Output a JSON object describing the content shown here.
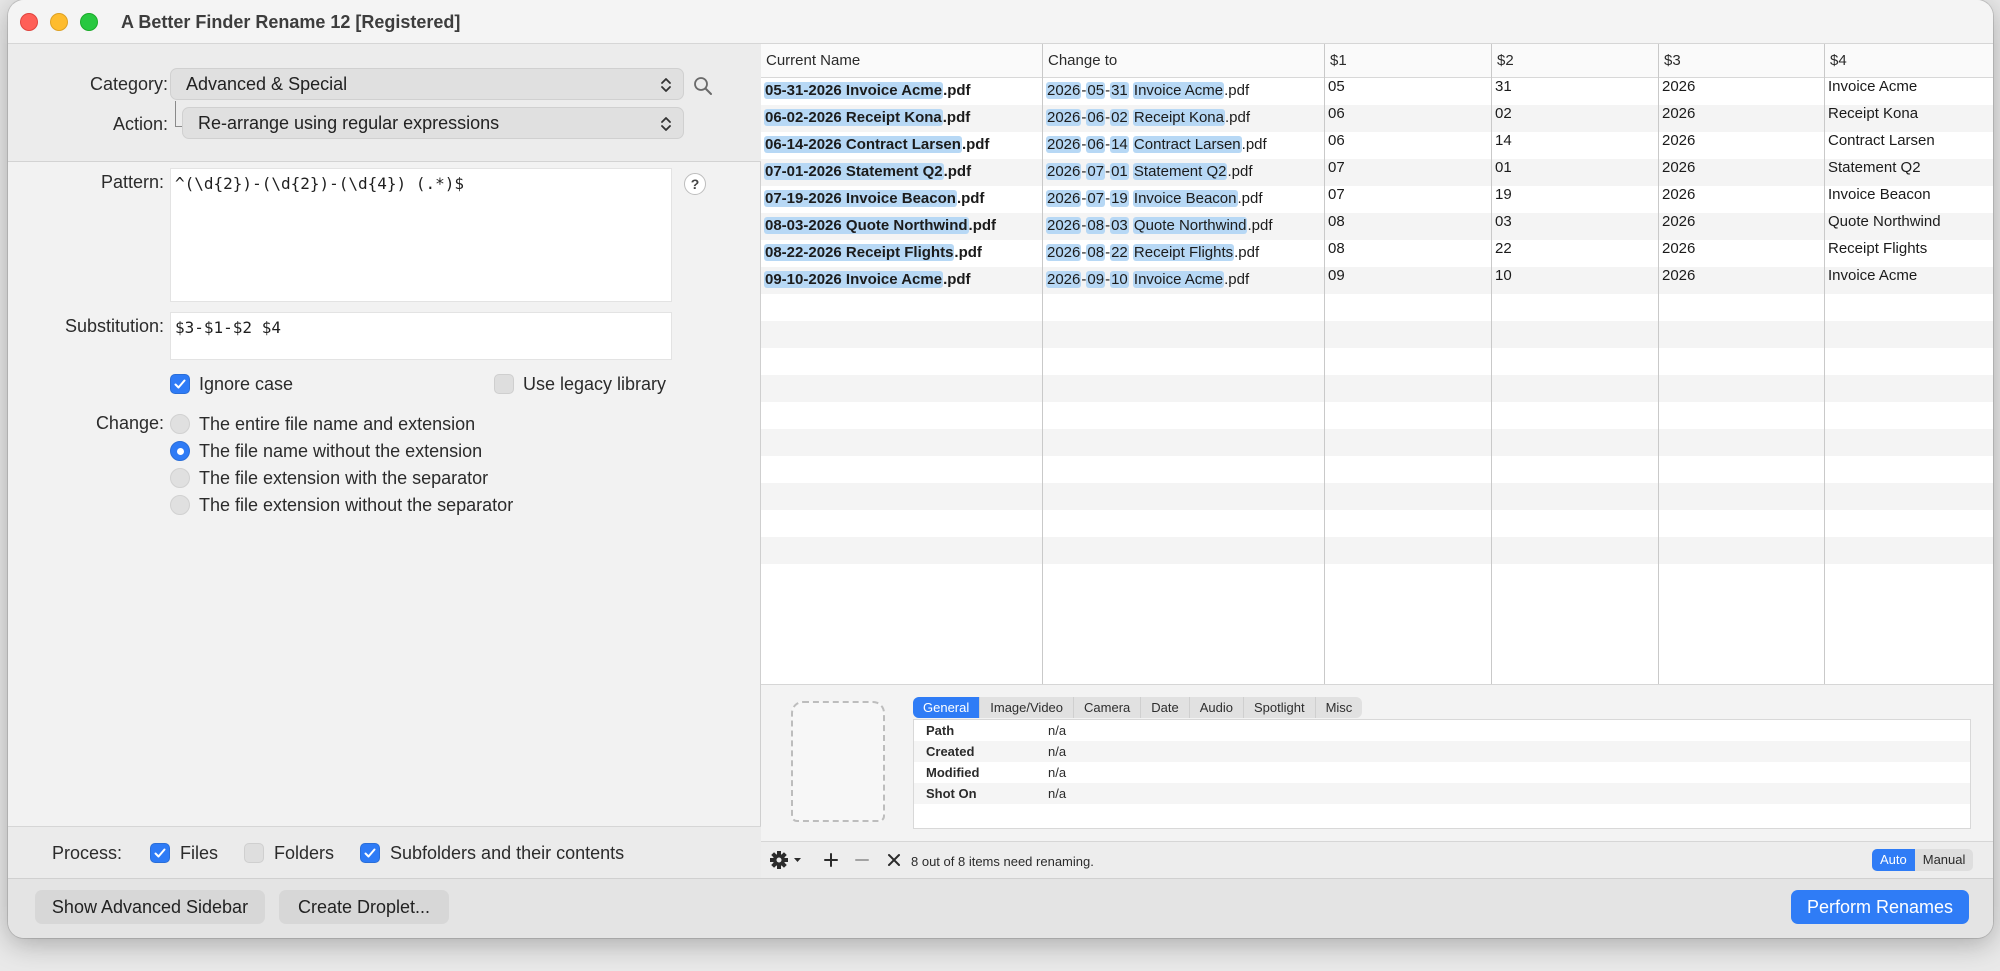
{
  "window": {
    "title": "A Better Finder Rename 12 [Registered]"
  },
  "controls": {
    "category_label": "Category:",
    "category_value": "Advanced & Special",
    "action_label": "Action:",
    "action_value": "Re-arrange using regular expressions",
    "pattern_label": "Pattern:",
    "pattern_value": "^(\\d{2})-(\\d{2})-(\\d{4}) (.*)$",
    "help_glyph": "?",
    "substitution_label": "Substitution:",
    "substitution_value": "$3-$1-$2 $4",
    "ignore_case_label": "Ignore case",
    "legacy_label": "Use legacy library",
    "change_label": "Change:",
    "change_options": [
      "The entire file name and extension",
      "The file name without the extension",
      "The file extension with the separator",
      "The file extension without the separator"
    ],
    "selected_change_index": 1
  },
  "process": {
    "label": "Process:",
    "files": "Files",
    "folders": "Folders",
    "subfolders": "Subfolders and their contents"
  },
  "table": {
    "headers": [
      "Current Name",
      "Change to",
      "$1",
      "$2",
      "$3",
      "$4"
    ],
    "rows": [
      {
        "cur": "05-31-2026 Invoice Acme",
        "ext": ".pdf",
        "to": [
          "2026",
          "05",
          "31",
          "Invoice Acme"
        ],
        "g": [
          "05",
          "31",
          "2026",
          "Invoice Acme"
        ]
      },
      {
        "cur": "06-02-2026 Receipt Kona",
        "ext": ".pdf",
        "to": [
          "2026",
          "06",
          "02",
          "Receipt Kona"
        ],
        "g": [
          "06",
          "02",
          "2026",
          "Receipt Kona"
        ]
      },
      {
        "cur": "06-14-2026 Contract Larsen",
        "ext": ".pdf",
        "to": [
          "2026",
          "06",
          "14",
          "Contract Larsen"
        ],
        "g": [
          "06",
          "14",
          "2026",
          "Contract Larsen"
        ]
      },
      {
        "cur": "07-01-2026 Statement Q2",
        "ext": ".pdf",
        "to": [
          "2026",
          "07",
          "01",
          "Statement Q2"
        ],
        "g": [
          "07",
          "01",
          "2026",
          "Statement Q2"
        ]
      },
      {
        "cur": "07-19-2026 Invoice Beacon",
        "ext": ".pdf",
        "to": [
          "2026",
          "07",
          "19",
          "Invoice Beacon"
        ],
        "g": [
          "07",
          "19",
          "2026",
          "Invoice Beacon"
        ]
      },
      {
        "cur": "08-03-2026 Quote Northwind",
        "ext": ".pdf",
        "to": [
          "2026",
          "08",
          "03",
          "Quote Northwind"
        ],
        "g": [
          "08",
          "03",
          "2026",
          "Quote Northwind"
        ]
      },
      {
        "cur": "08-22-2026 Receipt Flights",
        "ext": ".pdf",
        "to": [
          "2026",
          "08",
          "22",
          "Receipt Flights"
        ],
        "g": [
          "08",
          "22",
          "2026",
          "Receipt Flights"
        ]
      },
      {
        "cur": "09-10-2026 Invoice Acme",
        "ext": ".pdf",
        "to": [
          "2026",
          "09",
          "10",
          "Invoice Acme"
        ],
        "g": [
          "09",
          "10",
          "2026",
          "Invoice Acme"
        ]
      }
    ]
  },
  "info": {
    "tabs": [
      "General",
      "Image/Video",
      "Camera",
      "Date",
      "Audio",
      "Spotlight",
      "Misc"
    ],
    "active_tab": 0,
    "rows": [
      {
        "key": "Path",
        "value": "n/a"
      },
      {
        "key": "Created",
        "value": "n/a"
      },
      {
        "key": "Modified",
        "value": "n/a"
      },
      {
        "key": "Shot On",
        "value": "n/a"
      }
    ]
  },
  "status": {
    "text": "8 out of 8 items need renaming.",
    "auto": "Auto",
    "manual": "Manual"
  },
  "footer": {
    "show_sidebar": "Show Advanced Sidebar",
    "create_droplet": "Create Droplet...",
    "perform": "Perform Renames"
  },
  "colors": {
    "accent": "#2f7cf6",
    "highlight": "#b7d8f5"
  },
  "icons": [
    "search-icon",
    "help-icon",
    "gear-icon",
    "plus-icon",
    "minus-icon",
    "close-icon",
    "chevron-updown-icon"
  ]
}
